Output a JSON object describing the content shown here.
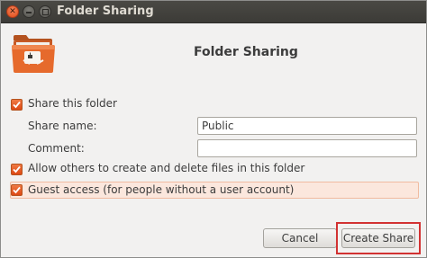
{
  "window": {
    "title": "Folder Sharing",
    "controls": [
      "close-icon",
      "minimize-icon",
      "maximize-icon"
    ]
  },
  "header": {
    "heading": "Folder Sharing",
    "icon": "folder-share-icon"
  },
  "form": {
    "share_this_folder": {
      "label": "Share this folder",
      "checked": true
    },
    "share_name": {
      "label": "Share name:",
      "value": "Public"
    },
    "comment": {
      "label": "Comment:",
      "value": ""
    },
    "allow_others": {
      "label": "Allow others to create and delete files in this folder",
      "checked": true
    },
    "guest_access": {
      "label": "Guest access (for people without a user account)",
      "checked": true
    }
  },
  "buttons": {
    "cancel": "Cancel",
    "create_share": "Create Share"
  },
  "colors": {
    "accent": "#dd4814",
    "titlebar": "#3c3b37",
    "highlight": "#d23232"
  }
}
